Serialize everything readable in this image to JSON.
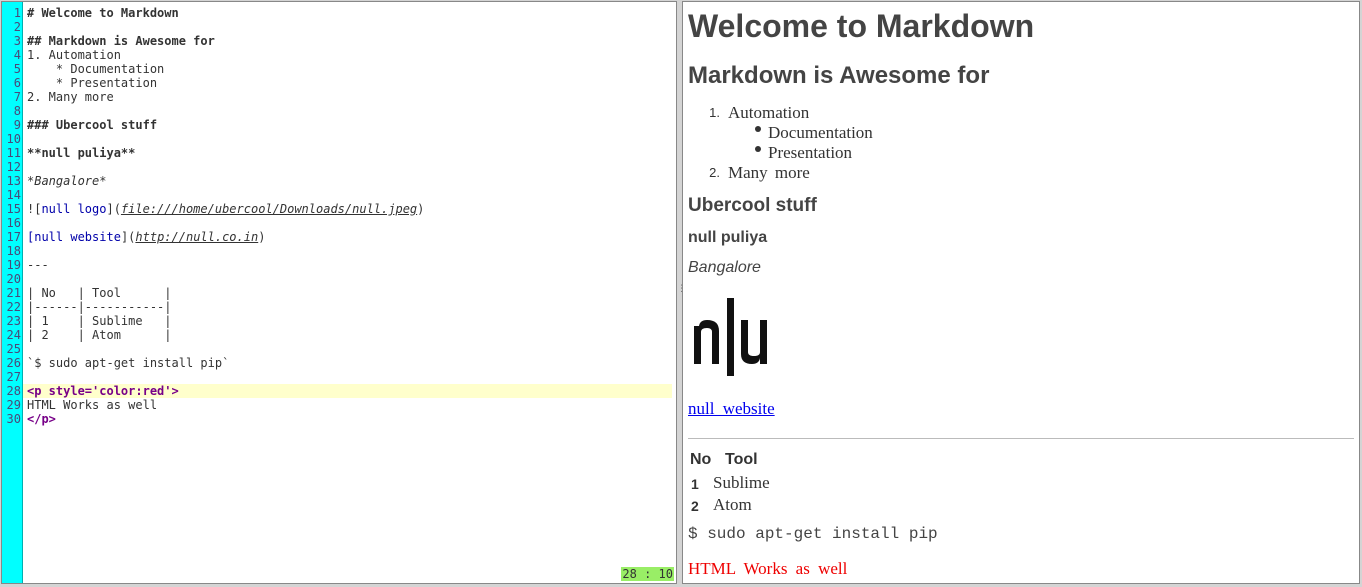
{
  "editor": {
    "line_numbers": [
      "1",
      "2",
      "3",
      "4",
      "5",
      "6",
      "7",
      "8",
      "9",
      "10",
      "11",
      "12",
      "13",
      "14",
      "15",
      "16",
      "17",
      "18",
      "19",
      "20",
      "21",
      "22",
      "23",
      "24",
      "25",
      "26",
      "27",
      "28",
      "29",
      "30"
    ],
    "lines": {
      "l1": "# Welcome to Markdown",
      "l3": "## Markdown is Awesome for",
      "l4": "1. Automation",
      "l5": "    * Documentation",
      "l6": "    * Presentation",
      "l7": "2. Many more",
      "l9": "### Ubercool stuff",
      "l11": "**null puliya**",
      "l13": "*Bangalore*",
      "l15_pre": "![",
      "l15_text": "null logo",
      "l15_mid": "](",
      "l15_url": "file:///home/ubercool/Downloads/null.jpeg",
      "l15_end": ")",
      "l17_pre": "[",
      "l17_text": "null website",
      "l17_mid": "](",
      "l17_url": "http://null.co.in",
      "l17_end": ")",
      "l19": "---",
      "l21": "| No   | Tool      |",
      "l22": "|------|-----------|",
      "l23": "| 1    | Sublime   |",
      "l24": "| 2    | Atom      |",
      "l26": "`$ sudo apt-get install pip`",
      "l28": "<p style='color:red'>",
      "l29": "HTML Works as well",
      "l30": "</p>"
    },
    "status": "28 : 10"
  },
  "preview": {
    "h1": "Welcome to Markdown",
    "h2": "Markdown is Awesome for",
    "ol": [
      {
        "num": "1.",
        "text": "Automation"
      },
      {
        "num": "2.",
        "text": "Many more"
      }
    ],
    "ul": [
      "Documentation",
      "Presentation"
    ],
    "h3": "Ubercool stuff",
    "strong": "null puliya",
    "em": "Bangalore",
    "logo_alt": "null logo",
    "link": "null website",
    "table": {
      "headers": [
        "No",
        "Tool"
      ],
      "rows": [
        [
          "1",
          "Sublime"
        ],
        [
          "2",
          "Atom"
        ]
      ]
    },
    "code": "$ sudo apt-get install pip",
    "red_text": "HTML Works as well",
    "colors": {
      "gutter": "#00ffff",
      "status_bg": "#99ee66",
      "current_line": "#ffffcc",
      "link": "#0000ee",
      "red": "#ee0000"
    }
  }
}
